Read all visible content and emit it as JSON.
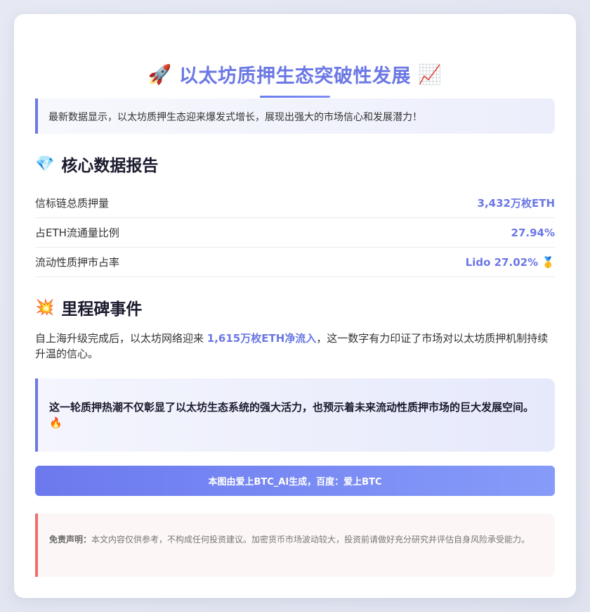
{
  "header": {
    "title": "以太坊质押生态突破性发展",
    "left_emoji": "🚀",
    "right_emoji": "📈"
  },
  "intro": "最新数据显示，以太坊质押生态迎来爆发式增长，展现出强大的市场信心和发展潜力！",
  "core": {
    "emoji": "💎",
    "title": "核心数据报告",
    "rows": [
      {
        "label": "信标链总质押量",
        "value": "3,432万枚ETH"
      },
      {
        "label": "占ETH流通量比例",
        "value": "27.94%"
      },
      {
        "label": "流动性质押市占率",
        "value": "Lido 27.02% 🥇"
      }
    ]
  },
  "milestone": {
    "emoji": "💥",
    "title": "里程碑事件",
    "text_before": "自上海升级完成后，以太坊网络迎来 ",
    "highlight": "1,615万枚ETH净流入",
    "text_after": "，这一数字有力印证了市场对以太坊质押机制持续升温的信心。"
  },
  "quote": "这一轮质押热潮不仅彰显了以太坊生态系统的强大活力，也预示着未来流动性质押市场的巨大发展空间。🔥",
  "banner": "本图由爱上BTC_AI生成，百度：爱上BTC",
  "disclaimer": {
    "label": "免责声明：",
    "text": "本文内容仅供参考，不构成任何投资建议。加密货币市场波动较大，投资前请做好充分研究并评估自身风险承受能力。"
  },
  "colors": {
    "accent": "#6b78e5",
    "warning": "#ee6e6e"
  }
}
